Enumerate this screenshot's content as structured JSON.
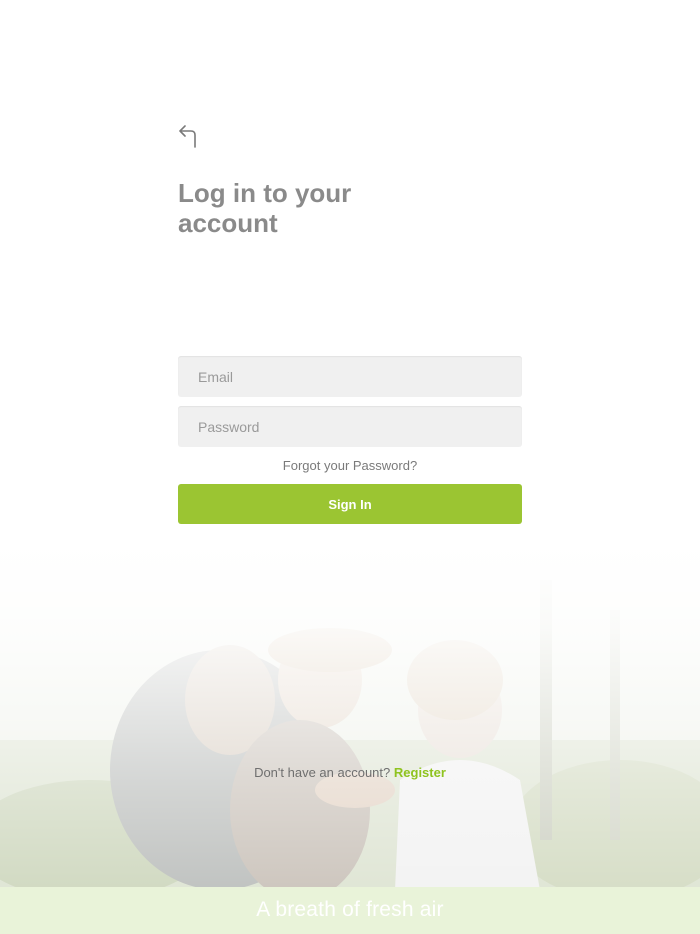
{
  "header": {
    "back_icon": "back-arrow-icon",
    "title": "Log in to your account"
  },
  "form": {
    "email_placeholder": "Email",
    "password_placeholder": "Password",
    "forgot_label": "Forgot your Password?",
    "signin_label": "Sign In"
  },
  "register": {
    "prompt": "Don't have an account?",
    "link_label": "Register"
  },
  "footer": {
    "tagline": "A breath of fresh air"
  },
  "colors": {
    "accent": "#9bc532",
    "link": "#8fc31f",
    "title": "#8a8a8a",
    "footer_bg": "#e9f3d9"
  }
}
